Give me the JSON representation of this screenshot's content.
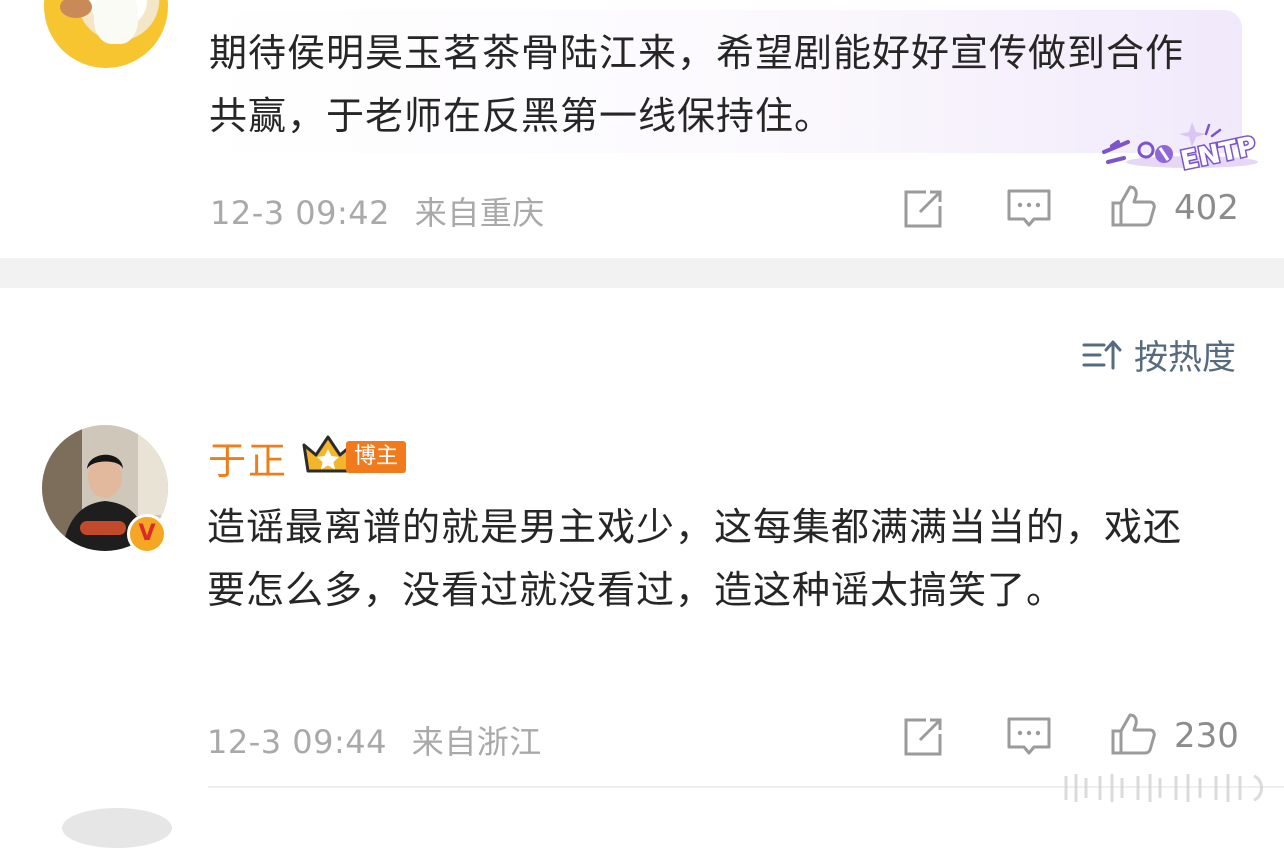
{
  "comments": [
    {
      "text": "期待侯明昊玉茗茶骨陆江来，希望剧能好好宣传做到合作共赢，于老师在反黑第一线保持住。",
      "time": "12-3 09:42",
      "location": "来自重庆",
      "likes": "402",
      "sticker_text": "ENTP"
    },
    {
      "username": "于正",
      "badge": "博主",
      "verified_mark": "V",
      "text": "造谣最离谱的就是男主戏少，这每集都满满当当的，戏还要怎么多，没看过就没看过，造这种谣太搞笑了。",
      "time": "12-3 09:44",
      "location": "来自浙江",
      "likes": "230"
    }
  ],
  "sort": {
    "label": "按热度",
    "icon": "sort-icon"
  },
  "icons": [
    "share-icon",
    "comment-icon",
    "like-icon"
  ],
  "colors": {
    "username": "#ef7d1a",
    "badge_bg": "#f07a1c",
    "sort_text": "#566b80",
    "meta_text": "#a9a9a9"
  }
}
